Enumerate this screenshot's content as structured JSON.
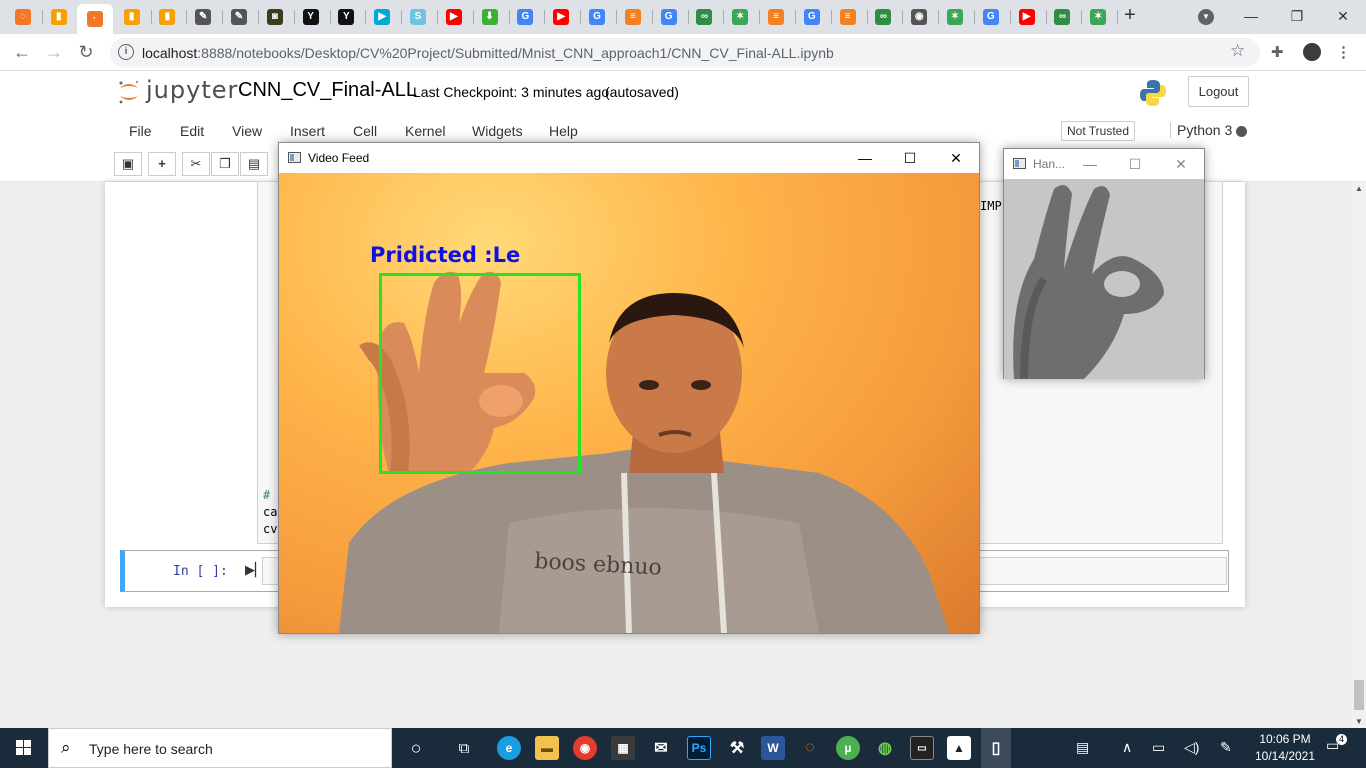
{
  "browser": {
    "tab_favicons": [
      {
        "icon": "jupyter-icon",
        "color": "#f37726",
        "glyph": "◌"
      },
      {
        "icon": "book-icon",
        "color": "#f6a000",
        "glyph": "▮"
      },
      {
        "icon": "active-tab-icon",
        "color": "#f37726",
        "glyph": "·"
      },
      {
        "icon": "book-icon",
        "color": "#f6a000",
        "glyph": "▮"
      },
      {
        "icon": "book-icon",
        "color": "#f6a000",
        "glyph": "▮"
      },
      {
        "icon": "feather-icon",
        "color": "#555555",
        "glyph": "✎"
      },
      {
        "icon": "feather-icon",
        "color": "#555555",
        "glyph": "✎"
      },
      {
        "icon": "mask-icon",
        "color": "#3b3b1f",
        "glyph": "◙"
      },
      {
        "icon": "ycombinator-icon",
        "color": "#111111",
        "glyph": "Y"
      },
      {
        "icon": "ycombinator-icon",
        "color": "#111111",
        "glyph": "Y"
      },
      {
        "icon": "play-icon",
        "color": "#00a8d6",
        "glyph": "▶"
      },
      {
        "icon": "s-icon",
        "color": "#6fc3df",
        "glyph": "S"
      },
      {
        "icon": "youtube-icon",
        "color": "#ff0000",
        "glyph": "▶"
      },
      {
        "icon": "download-icon",
        "color": "#3cb034",
        "glyph": "⬇"
      },
      {
        "icon": "google-icon",
        "color": "#4285f4",
        "glyph": "G"
      },
      {
        "icon": "youtube-icon",
        "color": "#ff0000",
        "glyph": "▶"
      },
      {
        "icon": "google-icon",
        "color": "#4285f4",
        "glyph": "G"
      },
      {
        "icon": "stackoverflow-icon",
        "color": "#f48024",
        "glyph": "≡"
      },
      {
        "icon": "google-icon",
        "color": "#4285f4",
        "glyph": "G"
      },
      {
        "icon": "geeksforgeeks-icon",
        "color": "#2f8d46",
        "glyph": "∞"
      },
      {
        "icon": "stars-icon",
        "color": "#3aa757",
        "glyph": "✶"
      },
      {
        "icon": "stackoverflow-icon",
        "color": "#f48024",
        "glyph": "≡"
      },
      {
        "icon": "google-icon",
        "color": "#4285f4",
        "glyph": "G"
      },
      {
        "icon": "stackoverflow-icon",
        "color": "#f48024",
        "glyph": "≡"
      },
      {
        "icon": "geeksforgeeks-icon",
        "color": "#2f8d46",
        "glyph": "∞"
      },
      {
        "icon": "globe-icon",
        "color": "#555555",
        "glyph": "◉"
      },
      {
        "icon": "stars-icon",
        "color": "#3aa757",
        "glyph": "✶"
      },
      {
        "icon": "google-icon",
        "color": "#4285f4",
        "glyph": "G"
      },
      {
        "icon": "youtube-icon",
        "color": "#ff0000",
        "glyph": "▶"
      },
      {
        "icon": "geeksforgeeks-icon",
        "color": "#2f8d46",
        "glyph": "∞"
      },
      {
        "icon": "stars-icon",
        "color": "#3aa757",
        "glyph": "✶"
      }
    ],
    "new_tab_label": "+",
    "url_host": "localhost",
    "url_path": ":8888/notebooks/Desktop/CV%20Project/Submitted/Mnist_CNN_approach1/CNN_CV_Final-ALL.ipynb"
  },
  "jupyter": {
    "logo_text": "jupyter",
    "notebook_name": "CNN_CV_Final-ALL",
    "checkpoint": "Last Checkpoint: 3 minutes ago",
    "autosave": "(autosaved)",
    "logout": "Logout",
    "menu": [
      "File",
      "Edit",
      "View",
      "Insert",
      "Cell",
      "Kernel",
      "Widgets",
      "Help"
    ],
    "trust": "Not Trusted",
    "kernel": "Python 3",
    "accent_color": "#42a5f5"
  },
  "notebook": {
    "code_fragment_right": "IMP",
    "code_lines_left": [
      "# ",
      "ca",
      "cv"
    ],
    "prompt": "In [ ]:"
  },
  "video_window": {
    "title": "Video Feed",
    "prediction_text": "Pridicted :Le",
    "box_color": "#22e622",
    "text_color": "#1010e0"
  },
  "hand_window": {
    "title": "Han..."
  },
  "taskbar": {
    "search_placeholder": "Type here to search",
    "time": "10:06 PM",
    "date": "10/14/2021",
    "notification_count": "4"
  }
}
